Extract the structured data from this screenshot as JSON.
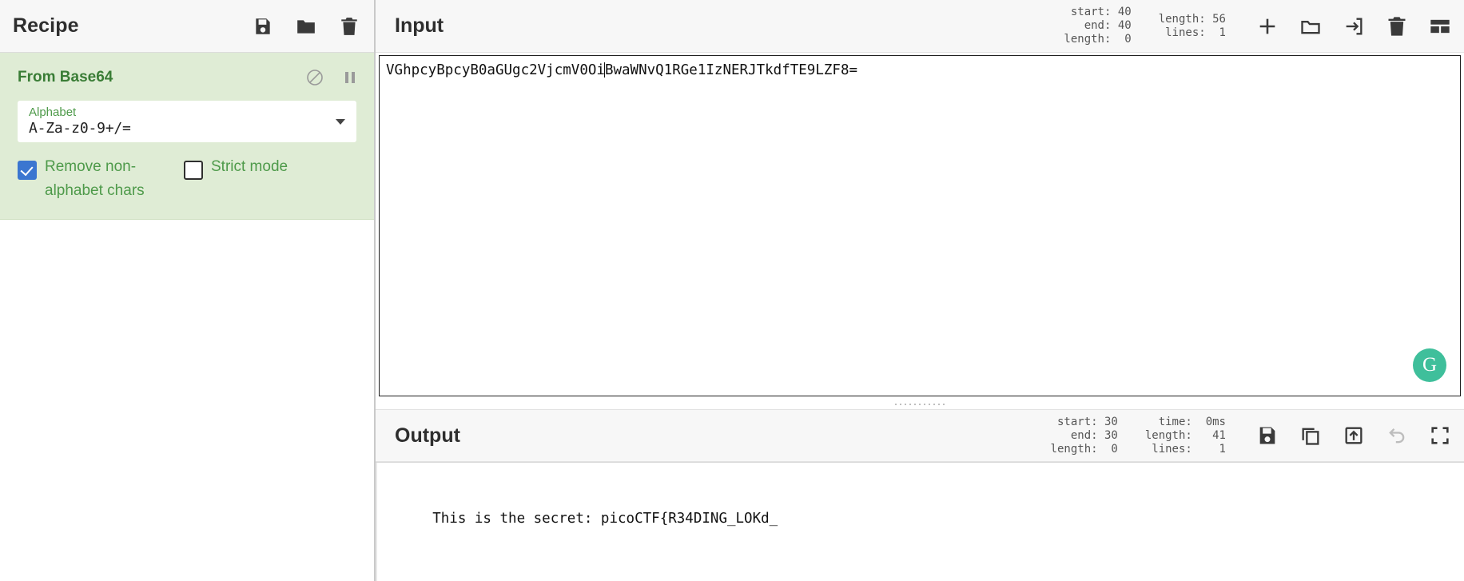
{
  "recipe": {
    "title": "Recipe",
    "header_icons": [
      {
        "name": "save-recipe-icon",
        "glyph": "save"
      },
      {
        "name": "load-recipe-icon",
        "glyph": "folder"
      },
      {
        "name": "clear-recipe-icon",
        "glyph": "trash"
      }
    ],
    "operation": {
      "title": "From Base64",
      "disable_icon": "disable-icon",
      "pause_icon": "breakpoint-pause-icon",
      "arg_label": "Alphabet",
      "arg_value": "A-Za-z0-9+/=",
      "checkbox_1_label": "Remove non-alphabet chars",
      "checkbox_1_checked": true,
      "checkbox_2_label": "Strict mode",
      "checkbox_2_checked": false
    }
  },
  "input": {
    "title": "Input",
    "stats_left": "start: 40\n  end: 40\nlength:  0",
    "stats_right": "length: 56\n lines:  1",
    "text_before_caret": "VGhpcyBpcyB0aGUgc2VjcmV0Oi",
    "text_after_caret": "BwaWNvQ1RGe1IzNERJTkdfTE9LZF8=",
    "full_text": "VGhpcyBpcyB0aGUgc2VjcmV0OiBwaWNvQ1RGe1IzNERJTkdfTE9LZF8=",
    "grammarly_badge": "G",
    "icons": [
      {
        "name": "add-input-tab-icon",
        "glyph": "plus"
      },
      {
        "name": "open-folder-input-icon",
        "glyph": "folder-outline"
      },
      {
        "name": "open-file-as-input-icon",
        "glyph": "import"
      },
      {
        "name": "clear-input-icon",
        "glyph": "trash"
      },
      {
        "name": "toggle-panel-layout-icon",
        "glyph": "panels"
      }
    ]
  },
  "output": {
    "title": "Output",
    "stats_left": "start: 30\n  end: 30\nlength:  0",
    "stats_right": "  time:  0ms\nlength:   41\n lines:    1",
    "text": "This is the secret: picoCTF{R34DING_LOKd_",
    "icons": [
      {
        "name": "save-output-icon",
        "glyph": "save"
      },
      {
        "name": "copy-output-icon",
        "glyph": "copy"
      },
      {
        "name": "replace-input-with-output-icon",
        "glyph": "export"
      },
      {
        "name": "undo-icon",
        "glyph": "undo",
        "disabled": true
      },
      {
        "name": "maximise-output-icon",
        "glyph": "maximise"
      }
    ]
  },
  "colors": {
    "operation_bg": "#dfecd5",
    "operation_title": "#3a7d36",
    "checkbox_checked": "#3b76d0",
    "grammarly": "#3fbf9b"
  }
}
